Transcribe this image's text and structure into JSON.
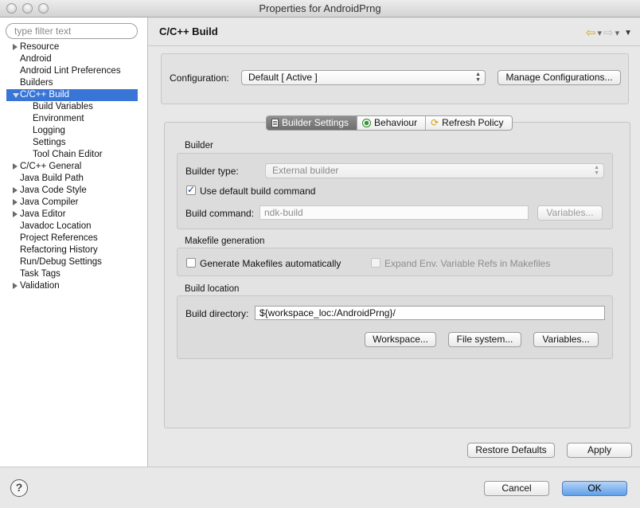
{
  "window": {
    "title": "Properties for AndroidPrng"
  },
  "sidebar": {
    "filter_placeholder": "type filter text",
    "items": [
      {
        "label": "Resource",
        "expander": "collapsed"
      },
      {
        "label": "Android"
      },
      {
        "label": "Android Lint Preferences"
      },
      {
        "label": "Builders"
      },
      {
        "label": "C/C++ Build",
        "expander": "expanded",
        "selected": true
      },
      {
        "label": "Build Variables",
        "child": true
      },
      {
        "label": "Environment",
        "child": true
      },
      {
        "label": "Logging",
        "child": true
      },
      {
        "label": "Settings",
        "child": true
      },
      {
        "label": "Tool Chain Editor",
        "child": true
      },
      {
        "label": "C/C++ General",
        "expander": "collapsed"
      },
      {
        "label": "Java Build Path"
      },
      {
        "label": "Java Code Style",
        "expander": "collapsed"
      },
      {
        "label": "Java Compiler",
        "expander": "collapsed"
      },
      {
        "label": "Java Editor",
        "expander": "collapsed"
      },
      {
        "label": "Javadoc Location"
      },
      {
        "label": "Project References"
      },
      {
        "label": "Refactoring History"
      },
      {
        "label": "Run/Debug Settings"
      },
      {
        "label": "Task Tags"
      },
      {
        "label": "Validation",
        "expander": "collapsed"
      }
    ]
  },
  "main": {
    "title": "C/C++ Build",
    "nav": {
      "back": "⇦",
      "forward": "⇨",
      "menu": "▼",
      "dropdown": "▾"
    },
    "configuration": {
      "label": "Configuration:",
      "value": "Default  [ Active ]",
      "manage_button": "Manage Configurations..."
    },
    "tabs": [
      {
        "label": "Builder Settings",
        "icon": "document-icon",
        "active": true
      },
      {
        "label": "Behaviour",
        "icon": "radio-icon"
      },
      {
        "label": "Refresh Policy",
        "icon": "refresh-icon"
      }
    ],
    "builder": {
      "group_title": "Builder",
      "type_label": "Builder type:",
      "type_value": "External builder",
      "use_default_label": "Use default build command",
      "use_default_checked": true,
      "command_label": "Build command:",
      "command_value": "ndk-build",
      "variables_button": "Variables..."
    },
    "makefile": {
      "group_title": "Makefile generation",
      "generate_label": "Generate Makefiles automatically",
      "generate_checked": false,
      "expand_label": "Expand Env. Variable Refs in Makefiles",
      "expand_checked": false
    },
    "location": {
      "group_title": "Build location",
      "dir_label": "Build directory:",
      "dir_value": "${workspace_loc:/AndroidPrng}/",
      "workspace_button": "Workspace...",
      "filesystem_button": "File system...",
      "variables_button": "Variables..."
    },
    "restore_button": "Restore Defaults",
    "apply_button": "Apply"
  },
  "footer": {
    "help": "?",
    "cancel_button": "Cancel",
    "ok_button": "OK"
  },
  "colors": {
    "selection": "#3875d7",
    "primary_button": "#5fa0ea",
    "back_arrow": "#d9a316"
  }
}
